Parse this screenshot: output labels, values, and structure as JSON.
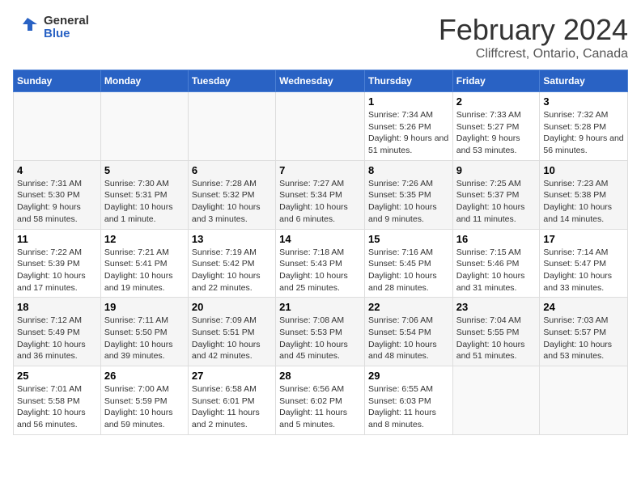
{
  "header": {
    "logo_line1": "General",
    "logo_line2": "Blue",
    "main_title": "February 2024",
    "subtitle": "Cliffcrest, Ontario, Canada"
  },
  "days_of_week": [
    "Sunday",
    "Monday",
    "Tuesday",
    "Wednesday",
    "Thursday",
    "Friday",
    "Saturday"
  ],
  "weeks": [
    [
      {
        "day": "",
        "info": ""
      },
      {
        "day": "",
        "info": ""
      },
      {
        "day": "",
        "info": ""
      },
      {
        "day": "",
        "info": ""
      },
      {
        "day": "1",
        "info": "Sunrise: 7:34 AM\nSunset: 5:26 PM\nDaylight: 9 hours and 51 minutes."
      },
      {
        "day": "2",
        "info": "Sunrise: 7:33 AM\nSunset: 5:27 PM\nDaylight: 9 hours and 53 minutes."
      },
      {
        "day": "3",
        "info": "Sunrise: 7:32 AM\nSunset: 5:28 PM\nDaylight: 9 hours and 56 minutes."
      }
    ],
    [
      {
        "day": "4",
        "info": "Sunrise: 7:31 AM\nSunset: 5:30 PM\nDaylight: 9 hours and 58 minutes."
      },
      {
        "day": "5",
        "info": "Sunrise: 7:30 AM\nSunset: 5:31 PM\nDaylight: 10 hours and 1 minute."
      },
      {
        "day": "6",
        "info": "Sunrise: 7:28 AM\nSunset: 5:32 PM\nDaylight: 10 hours and 3 minutes."
      },
      {
        "day": "7",
        "info": "Sunrise: 7:27 AM\nSunset: 5:34 PM\nDaylight: 10 hours and 6 minutes."
      },
      {
        "day": "8",
        "info": "Sunrise: 7:26 AM\nSunset: 5:35 PM\nDaylight: 10 hours and 9 minutes."
      },
      {
        "day": "9",
        "info": "Sunrise: 7:25 AM\nSunset: 5:37 PM\nDaylight: 10 hours and 11 minutes."
      },
      {
        "day": "10",
        "info": "Sunrise: 7:23 AM\nSunset: 5:38 PM\nDaylight: 10 hours and 14 minutes."
      }
    ],
    [
      {
        "day": "11",
        "info": "Sunrise: 7:22 AM\nSunset: 5:39 PM\nDaylight: 10 hours and 17 minutes."
      },
      {
        "day": "12",
        "info": "Sunrise: 7:21 AM\nSunset: 5:41 PM\nDaylight: 10 hours and 19 minutes."
      },
      {
        "day": "13",
        "info": "Sunrise: 7:19 AM\nSunset: 5:42 PM\nDaylight: 10 hours and 22 minutes."
      },
      {
        "day": "14",
        "info": "Sunrise: 7:18 AM\nSunset: 5:43 PM\nDaylight: 10 hours and 25 minutes."
      },
      {
        "day": "15",
        "info": "Sunrise: 7:16 AM\nSunset: 5:45 PM\nDaylight: 10 hours and 28 minutes."
      },
      {
        "day": "16",
        "info": "Sunrise: 7:15 AM\nSunset: 5:46 PM\nDaylight: 10 hours and 31 minutes."
      },
      {
        "day": "17",
        "info": "Sunrise: 7:14 AM\nSunset: 5:47 PM\nDaylight: 10 hours and 33 minutes."
      }
    ],
    [
      {
        "day": "18",
        "info": "Sunrise: 7:12 AM\nSunset: 5:49 PM\nDaylight: 10 hours and 36 minutes."
      },
      {
        "day": "19",
        "info": "Sunrise: 7:11 AM\nSunset: 5:50 PM\nDaylight: 10 hours and 39 minutes."
      },
      {
        "day": "20",
        "info": "Sunrise: 7:09 AM\nSunset: 5:51 PM\nDaylight: 10 hours and 42 minutes."
      },
      {
        "day": "21",
        "info": "Sunrise: 7:08 AM\nSunset: 5:53 PM\nDaylight: 10 hours and 45 minutes."
      },
      {
        "day": "22",
        "info": "Sunrise: 7:06 AM\nSunset: 5:54 PM\nDaylight: 10 hours and 48 minutes."
      },
      {
        "day": "23",
        "info": "Sunrise: 7:04 AM\nSunset: 5:55 PM\nDaylight: 10 hours and 51 minutes."
      },
      {
        "day": "24",
        "info": "Sunrise: 7:03 AM\nSunset: 5:57 PM\nDaylight: 10 hours and 53 minutes."
      }
    ],
    [
      {
        "day": "25",
        "info": "Sunrise: 7:01 AM\nSunset: 5:58 PM\nDaylight: 10 hours and 56 minutes."
      },
      {
        "day": "26",
        "info": "Sunrise: 7:00 AM\nSunset: 5:59 PM\nDaylight: 10 hours and 59 minutes."
      },
      {
        "day": "27",
        "info": "Sunrise: 6:58 AM\nSunset: 6:01 PM\nDaylight: 11 hours and 2 minutes."
      },
      {
        "day": "28",
        "info": "Sunrise: 6:56 AM\nSunset: 6:02 PM\nDaylight: 11 hours and 5 minutes."
      },
      {
        "day": "29",
        "info": "Sunrise: 6:55 AM\nSunset: 6:03 PM\nDaylight: 11 hours and 8 minutes."
      },
      {
        "day": "",
        "info": ""
      },
      {
        "day": "",
        "info": ""
      }
    ]
  ]
}
